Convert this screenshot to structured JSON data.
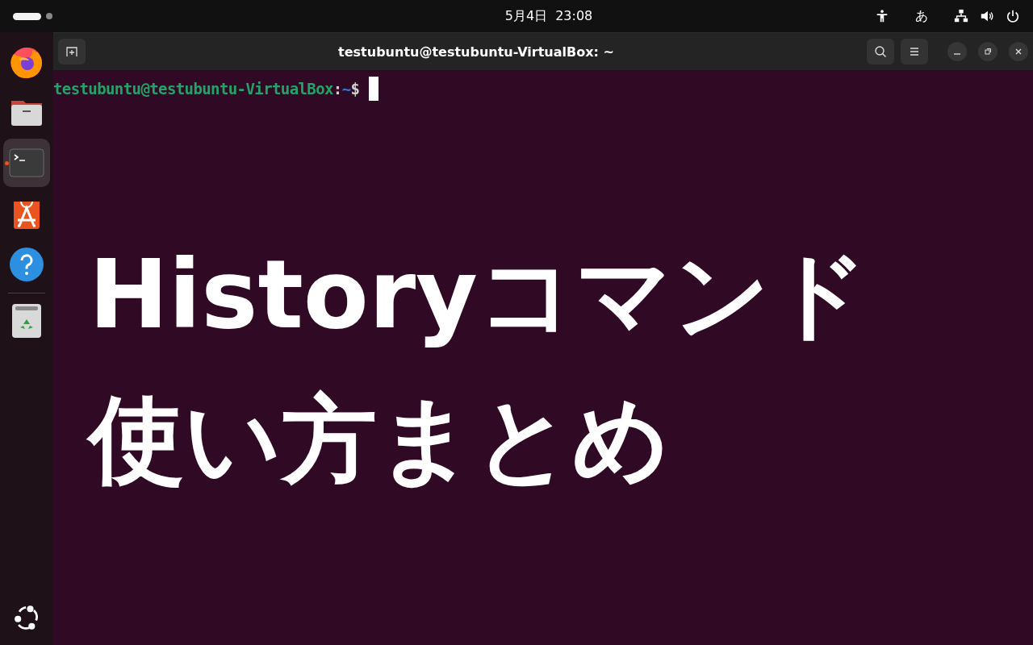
{
  "top_bar": {
    "date": "5月4日",
    "time": "23:08",
    "input_method": "あ"
  },
  "dock": {
    "items": [
      {
        "kind": "firefox",
        "running": false,
        "selected": false
      },
      {
        "kind": "files",
        "running": false,
        "selected": false
      },
      {
        "kind": "terminal",
        "running": true,
        "selected": true
      },
      {
        "kind": "appcenter",
        "running": false,
        "selected": false
      },
      {
        "kind": "help",
        "running": false,
        "selected": false
      },
      {
        "kind": "trash",
        "running": false,
        "selected": false
      }
    ]
  },
  "window": {
    "title": "testubuntu@testubuntu-VirtualBox: ~"
  },
  "terminal": {
    "prompt_user_host": "testubuntu@testubuntu-VirtualBox",
    "prompt_colon": ":",
    "prompt_path": "~",
    "prompt_symbol": "$"
  },
  "headline": {
    "lines": [
      "Historyコマンド",
      "使い方まとめ"
    ]
  }
}
